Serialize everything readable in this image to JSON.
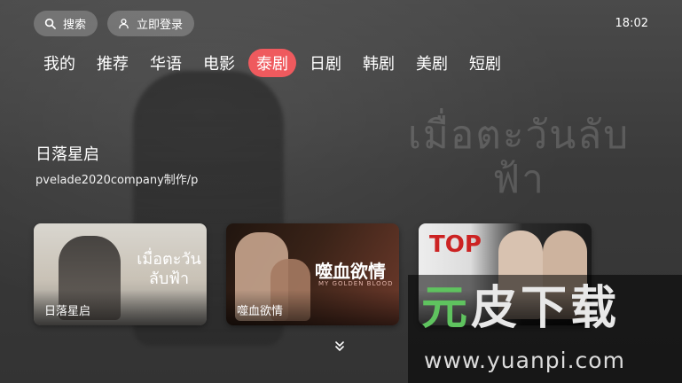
{
  "header": {
    "search_label": "搜索",
    "login_label": "立即登录",
    "time": "18:02"
  },
  "tabs": [
    {
      "label": "我的"
    },
    {
      "label": "推荐"
    },
    {
      "label": "华语"
    },
    {
      "label": "电影"
    },
    {
      "label": "泰剧",
      "active": true
    },
    {
      "label": "日剧"
    },
    {
      "label": "韩剧"
    },
    {
      "label": "美剧"
    },
    {
      "label": "短剧"
    }
  ],
  "feature": {
    "title": "日落星启",
    "subtitle": "pvelade2020company制作/p"
  },
  "cards": [
    {
      "title": "日落星启",
      "art_logo": "เมื่อตะวันลับฟ้า"
    },
    {
      "title": "噬血欲情",
      "art_logo": "噬血欲情",
      "art_logo_sub": "MY GOLDEN BLOOD"
    },
    {
      "title": "",
      "art_logo": "TOP"
    }
  ],
  "background_logo": "เมื่อตะวันลับฟ้า",
  "watermark": {
    "cn_green": "元",
    "cn_rest": "皮下载",
    "url": "www.yuanpi.com"
  },
  "colors": {
    "accent": "#ef5a5e",
    "watermark_green": "#5fc35f"
  },
  "icons": [
    "search-icon",
    "user-icon",
    "chevron-double-down-icon"
  ]
}
